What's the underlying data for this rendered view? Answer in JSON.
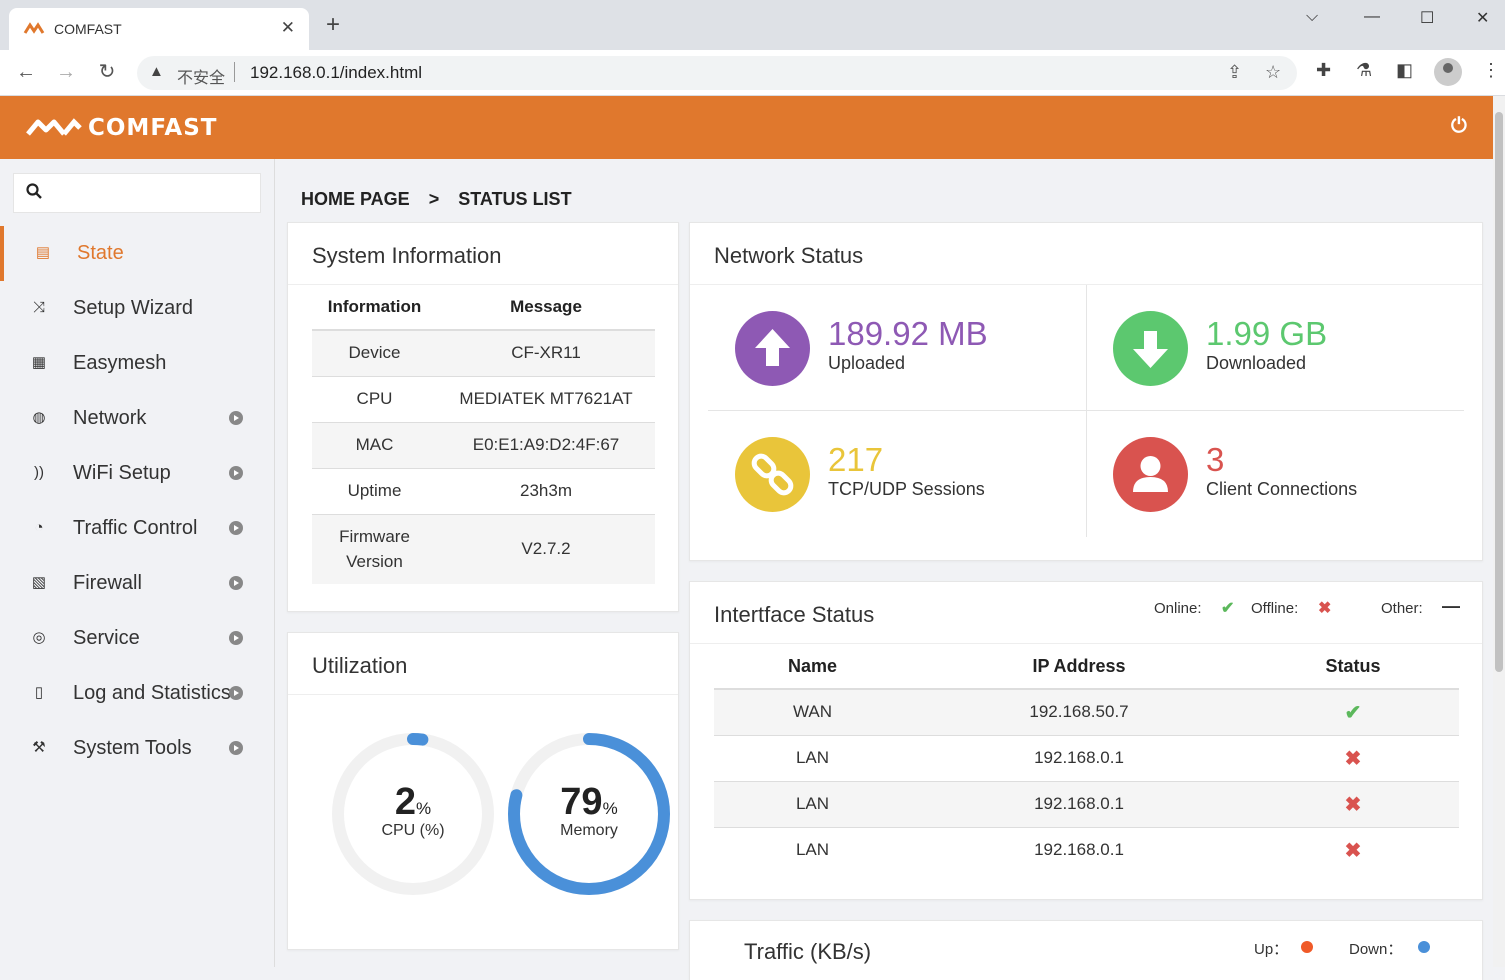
{
  "browser": {
    "tab_title": "COMFAST",
    "insecure_label": "不安全",
    "url": "192.168.0.1/index.html"
  },
  "header": {
    "brand": "COMFAST"
  },
  "search": {
    "placeholder": ""
  },
  "sidebar": {
    "items": [
      {
        "label": "State",
        "icon": "state-icon"
      },
      {
        "label": "Setup Wizard",
        "icon": "shuffle-icon"
      },
      {
        "label": "Easymesh",
        "icon": "easymesh-icon"
      },
      {
        "label": "Network",
        "icon": "globe-icon"
      },
      {
        "label": "WiFi Setup",
        "icon": "rss-icon"
      },
      {
        "label": "Traffic Control",
        "icon": "gauge-icon"
      },
      {
        "label": "Firewall",
        "icon": "firewall-icon"
      },
      {
        "label": "Service",
        "icon": "service-globe-icon"
      },
      {
        "label": "Log and Statistics",
        "icon": "log-icon"
      },
      {
        "label": "System Tools",
        "icon": "tools-icon"
      }
    ]
  },
  "breadcrumb": {
    "home": "HOME PAGE",
    "sep": ">",
    "current": "STATUS LIST"
  },
  "system_info": {
    "title": "System Information",
    "headers": [
      "Information",
      "Message"
    ],
    "rows": [
      [
        "Device",
        "CF-XR11"
      ],
      [
        "CPU",
        "MEDIATEK MT7621AT"
      ],
      [
        "MAC",
        "E0:E1:A9:D2:4F:67"
      ],
      [
        "Uptime",
        "23h3m"
      ],
      [
        "Firmware Version",
        "V2.7.2"
      ]
    ]
  },
  "network_status": {
    "title": "Network Status",
    "items": [
      {
        "value": "189.92 MB",
        "label": "Uploaded",
        "color": "#8e59b4"
      },
      {
        "value": "1.99 GB",
        "label": "Downloaded",
        "color": "#5cc86f"
      },
      {
        "value": "217",
        "label": "TCP/UDP Sessions",
        "color": "#e9c53a"
      },
      {
        "value": "3",
        "label": "Client Connections",
        "color": "#d9534f"
      }
    ]
  },
  "interface_status": {
    "title": "Intertface Status",
    "legend": {
      "online": "Online:",
      "offline": "Offline:",
      "other": "Other:"
    },
    "headers": [
      "Name",
      "IP Address",
      "Status"
    ],
    "rows": [
      {
        "name": "WAN",
        "ip": "192.168.50.7",
        "status": "online"
      },
      {
        "name": "LAN",
        "ip": "192.168.0.1",
        "status": "offline"
      },
      {
        "name": "LAN",
        "ip": "192.168.0.1",
        "status": "offline"
      },
      {
        "name": "LAN",
        "ip": "192.168.0.1",
        "status": "offline"
      }
    ]
  },
  "utilization": {
    "title": "Utilization",
    "cpu": {
      "value": "2",
      "unit": "%",
      "label": "CPU (%)",
      "percent": 2,
      "color": "#4a90d9"
    },
    "memory": {
      "value": "79",
      "unit": "%",
      "label": "Memory",
      "percent": 79,
      "color": "#4a90d9"
    }
  },
  "traffic": {
    "title": "Traffic (KB/s)",
    "legend": {
      "up": "Up：",
      "down": "Down：",
      "up_color": "#f05a28",
      "down_color": "#4a90d9"
    }
  }
}
